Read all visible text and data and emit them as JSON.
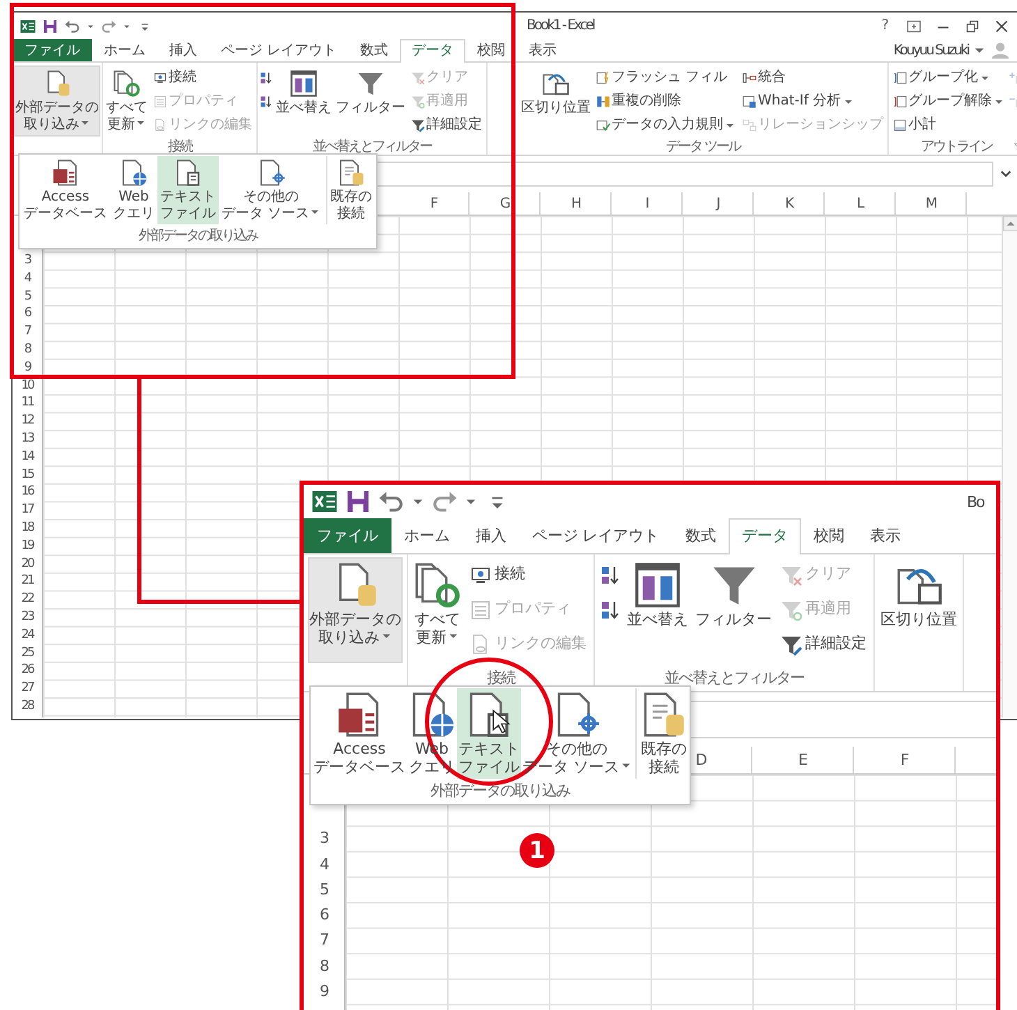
{
  "window": {
    "title": "Book1 - Excel",
    "help": "?",
    "account": "Kouyuu Suzuki",
    "tabs": [
      {
        "label": "ファイル",
        "kind": "file",
        "selected": false
      },
      {
        "label": "ホーム",
        "kind": "tab",
        "selected": false
      },
      {
        "label": "挿入",
        "kind": "tab",
        "selected": false
      },
      {
        "label": "ページ レイアウト",
        "kind": "tab",
        "selected": false
      },
      {
        "label": "数式",
        "kind": "tab",
        "selected": false
      },
      {
        "label": "データ",
        "kind": "tab",
        "selected": true
      },
      {
        "label": "校閲",
        "kind": "tab",
        "selected": false
      },
      {
        "label": "表示",
        "kind": "tab",
        "selected": false
      }
    ],
    "ribbon": [
      {
        "launcher": false,
        "columns": [
          {
            "kind": "large",
            "items": [
              {
                "kind": "import",
                "lines": [
                  "外部データの",
                  "取り込み"
                ],
                "dropdown": true,
                "disabled": false,
                "expanded": true
              }
            ]
          }
        ]
      },
      {
        "label": "接続",
        "launcher": false,
        "columns": [
          {
            "kind": "large",
            "items": [
              {
                "kind": "refresh",
                "lines": [
                  "すべて",
                  "更新"
                ],
                "dropdown": true,
                "disabled": false,
                "expanded": false
              }
            ]
          },
          {
            "kind": "small",
            "items": [
              {
                "kind": "connection",
                "label": "接続",
                "dropdown": false,
                "disabled": false,
                "expanded": false
              },
              {
                "kind": "properties",
                "label": "プロパティ",
                "dropdown": false,
                "disabled": true,
                "expanded": false
              },
              {
                "kind": "links",
                "label": "リンクの編集",
                "dropdown": false,
                "disabled": true,
                "expanded": false
              }
            ]
          }
        ]
      },
      {
        "label": "並べ替えとフィルター",
        "launcher": false,
        "columns": [
          {
            "kind": "small",
            "items": [
              {
                "kind": "sortaz",
                "dropdown": false,
                "disabled": false,
                "expanded": false
              },
              {
                "kind": "sortza",
                "dropdown": false,
                "disabled": false,
                "expanded": false
              }
            ]
          },
          {
            "kind": "large",
            "items": [
              {
                "kind": "sort",
                "lines": [
                  "並べ替え"
                ],
                "dropdown": false,
                "disabled": false,
                "expanded": false
              }
            ]
          },
          {
            "kind": "large",
            "items": [
              {
                "kind": "filter",
                "lines": [
                  "フィルター"
                ],
                "dropdown": false,
                "disabled": false,
                "expanded": false
              }
            ]
          },
          {
            "kind": "small",
            "items": [
              {
                "kind": "clear",
                "label": "クリア",
                "dropdown": false,
                "disabled": true,
                "expanded": false
              },
              {
                "kind": "reapply",
                "label": "再適用",
                "dropdown": false,
                "disabled": true,
                "expanded": false
              },
              {
                "kind": "advanced",
                "label": "詳細設定",
                "dropdown": false,
                "disabled": false,
                "expanded": false
              }
            ]
          }
        ]
      },
      {
        "label": "データ ツール",
        "launcher": false,
        "columns": [
          {
            "kind": "large",
            "items": [
              {
                "kind": "split",
                "lines": [
                  "区切り位置"
                ],
                "dropdown": false,
                "disabled": false,
                "expanded": false
              }
            ]
          },
          {
            "kind": "small",
            "items": [
              {
                "kind": "flash",
                "label": "フラッシュ フィル",
                "dropdown": false,
                "disabled": false,
                "expanded": false
              },
              {
                "kind": "dedupe",
                "label": "重複の削除",
                "dropdown": false,
                "disabled": false,
                "expanded": false
              },
              {
                "kind": "validation",
                "label": "データの入力規則",
                "dropdown": true,
                "disabled": false,
                "expanded": false
              }
            ]
          },
          {
            "kind": "small",
            "items": [
              {
                "kind": "consolidate",
                "label": "統合",
                "dropdown": false,
                "disabled": false,
                "expanded": false
              },
              {
                "kind": "whatif",
                "label": "What-If 分析",
                "dropdown": true,
                "disabled": false,
                "expanded": false
              },
              {
                "kind": "relationship",
                "label": "リレーションシップ",
                "dropdown": false,
                "disabled": true,
                "expanded": false
              }
            ]
          }
        ]
      },
      {
        "label": "アウトライン",
        "launcher": true,
        "columns": [
          {
            "kind": "small",
            "items": [
              {
                "kind": "group",
                "label": "グループ化",
                "dropdown": true,
                "disabled": false,
                "expanded": false
              },
              {
                "kind": "ungroup",
                "label": "グループ解除",
                "dropdown": true,
                "disabled": false,
                "expanded": false
              },
              {
                "kind": "subtotal",
                "label": "小計",
                "dropdown": false,
                "disabled": false,
                "expanded": false
              }
            ]
          },
          {
            "kind": "small",
            "items": [
              {
                "kind": "showdetail",
                "dropdown": false,
                "disabled": true,
                "expanded": false
              },
              {
                "kind": "hidedetail",
                "dropdown": false,
                "disabled": true,
                "expanded": false
              }
            ]
          }
        ]
      }
    ],
    "gallery": {
      "label": "外部データの取り込み",
      "items": [
        {
          "kind": "access",
          "lines": [
            "Access",
            "データベース"
          ],
          "dropdown": false,
          "separated": false,
          "selected": false
        },
        {
          "kind": "web",
          "lines": [
            "Web",
            "クエリ"
          ],
          "dropdown": false,
          "separated": false,
          "selected": false
        },
        {
          "kind": "text",
          "lines": [
            "テキスト",
            "ファイル"
          ],
          "dropdown": false,
          "separated": false,
          "selected": true
        },
        {
          "kind": "other",
          "lines": [
            "その他の",
            "データ ソース"
          ],
          "dropdown": true,
          "separated": false,
          "selected": false
        },
        {
          "kind": "existing",
          "lines": [
            "既存の",
            "接続"
          ],
          "dropdown": false,
          "separated": true,
          "selected": false
        }
      ]
    },
    "columns": [
      "F",
      "G",
      "H",
      "I",
      "J",
      "K",
      "L",
      "M"
    ],
    "rows": [
      "3",
      "4",
      "5",
      "6",
      "7",
      "8",
      "9",
      "10",
      "11",
      "12",
      "13",
      "14",
      "15",
      "16",
      "17",
      "18",
      "19",
      "20",
      "21",
      "22",
      "23",
      "24",
      "25",
      "26",
      "27",
      "28"
    ]
  },
  "callout": {
    "title": "Bo",
    "tabs": [
      {
        "label": "ファイル",
        "kind": "file",
        "selected": false
      },
      {
        "label": "ホーム",
        "kind": "tab",
        "selected": false
      },
      {
        "label": "挿入",
        "kind": "tab",
        "selected": false
      },
      {
        "label": "ページ レイアウト",
        "kind": "tab",
        "selected": false
      },
      {
        "label": "数式",
        "kind": "tab",
        "selected": false
      },
      {
        "label": "データ",
        "kind": "tab",
        "selected": true
      },
      {
        "label": "校閲",
        "kind": "tab",
        "selected": false
      },
      {
        "label": "表示",
        "kind": "tab",
        "selected": false
      }
    ],
    "ribbon": [
      {
        "launcher": false,
        "columns": [
          {
            "kind": "large",
            "items": [
              {
                "kind": "import",
                "lines": [
                  "外部データの",
                  "取り込み"
                ],
                "dropdown": true,
                "disabled": false,
                "expanded": true
              }
            ]
          }
        ]
      },
      {
        "label": "接続",
        "launcher": false,
        "columns": [
          {
            "kind": "large",
            "items": [
              {
                "kind": "refresh",
                "lines": [
                  "すべて",
                  "更新"
                ],
                "dropdown": true,
                "disabled": false,
                "expanded": false
              }
            ]
          },
          {
            "kind": "small",
            "items": [
              {
                "kind": "connection",
                "label": "接続",
                "dropdown": false,
                "disabled": false,
                "expanded": false
              },
              {
                "kind": "properties",
                "label": "プロパティ",
                "dropdown": false,
                "disabled": true,
                "expanded": false
              },
              {
                "kind": "links",
                "label": "リンクの編集",
                "dropdown": false,
                "disabled": true,
                "expanded": false
              }
            ]
          }
        ]
      },
      {
        "label": "並べ替えとフィルター",
        "launcher": false,
        "columns": [
          {
            "kind": "small",
            "items": [
              {
                "kind": "sortaz",
                "dropdown": false,
                "disabled": false,
                "expanded": false
              },
              {
                "kind": "sortza",
                "dropdown": false,
                "disabled": false,
                "expanded": false
              }
            ]
          },
          {
            "kind": "large",
            "items": [
              {
                "kind": "sort",
                "lines": [
                  "並べ替え"
                ],
                "dropdown": false,
                "disabled": false,
                "expanded": false
              }
            ]
          },
          {
            "kind": "large",
            "items": [
              {
                "kind": "filter",
                "lines": [
                  "フィルター"
                ],
                "dropdown": false,
                "disabled": false,
                "expanded": false
              }
            ]
          },
          {
            "kind": "small",
            "items": [
              {
                "kind": "clear",
                "label": "クリア",
                "dropdown": false,
                "disabled": true,
                "expanded": false
              },
              {
                "kind": "reapply",
                "label": "再適用",
                "dropdown": false,
                "disabled": true,
                "expanded": false
              },
              {
                "kind": "advanced",
                "label": "詳細設定",
                "dropdown": false,
                "disabled": false,
                "expanded": false
              }
            ]
          }
        ]
      },
      {
        "launcher": false,
        "columns": [
          {
            "kind": "large",
            "items": [
              {
                "kind": "split",
                "lines": [
                  "区切り位置"
                ],
                "dropdown": false,
                "disabled": false,
                "expanded": false
              }
            ]
          }
        ]
      }
    ],
    "gallery": {
      "label": "外部データの取り込み",
      "items": [
        {
          "kind": "access",
          "lines": [
            "Access",
            "データベース"
          ],
          "dropdown": false,
          "separated": false,
          "selected": false
        },
        {
          "kind": "web",
          "lines": [
            "Web",
            "クエリ"
          ],
          "dropdown": false,
          "separated": false,
          "selected": false
        },
        {
          "kind": "text",
          "lines": [
            "テキスト",
            "ファイル"
          ],
          "dropdown": false,
          "separated": false,
          "selected": true
        },
        {
          "kind": "other",
          "lines": [
            "その他の",
            "データ ソース"
          ],
          "dropdown": true,
          "separated": false,
          "selected": false
        },
        {
          "kind": "existing",
          "lines": [
            "既存の",
            "接続"
          ],
          "dropdown": false,
          "separated": true,
          "selected": false
        }
      ]
    },
    "columns": [
      "D",
      "E",
      "F"
    ],
    "rows": [
      "3",
      "4",
      "5",
      "6",
      "7",
      "8",
      "9"
    ]
  },
  "step_badge": "1"
}
